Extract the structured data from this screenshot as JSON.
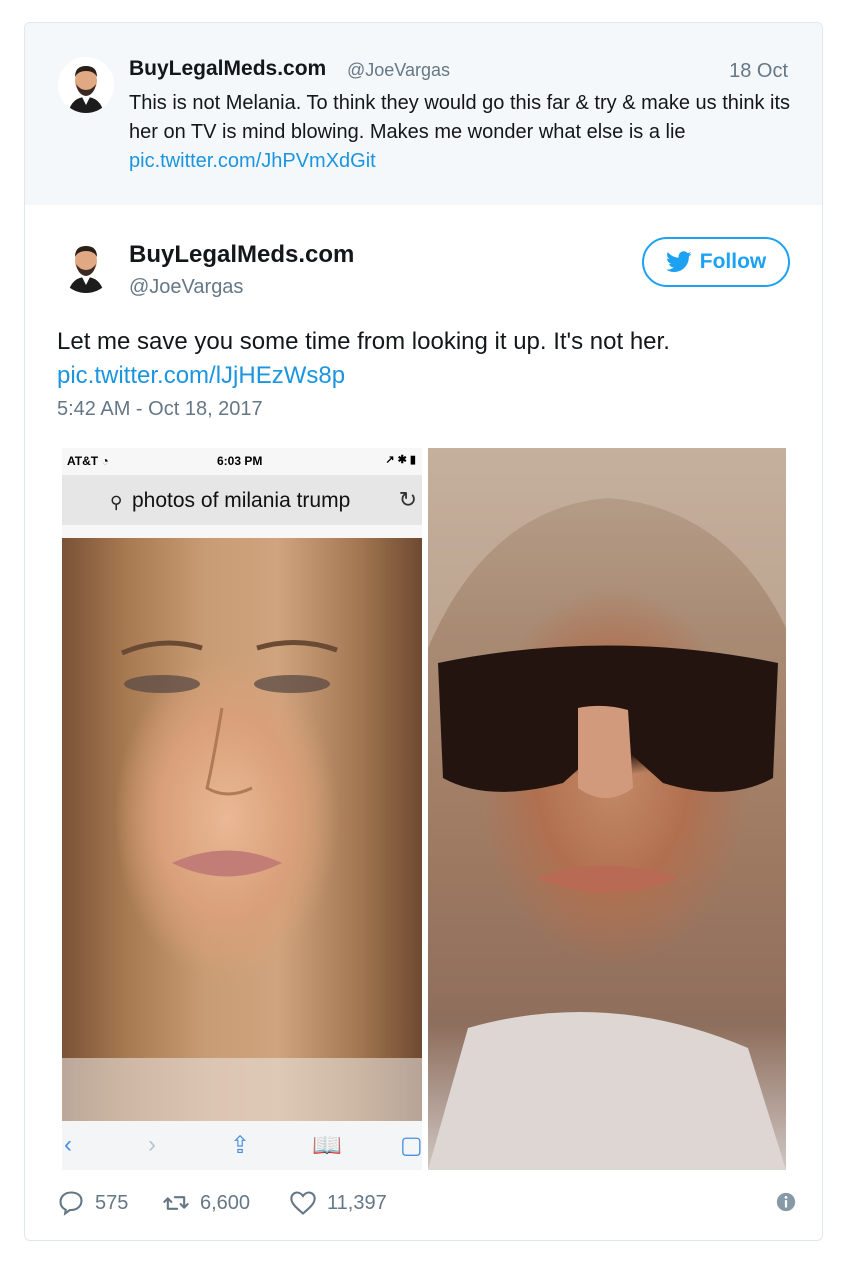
{
  "parent_tweet": {
    "name": "BuyLegalMeds.com",
    "handle": "@JoeVargas",
    "date": "18 Oct",
    "text": "This is not Melania. To think they would go this far & try & make us think its her on TV is mind blowing. Makes me wonder what else is a lie ",
    "link": "pic.twitter.com/JhPVmXdGit"
  },
  "main_tweet": {
    "name": "BuyLegalMeds.com",
    "handle": "@JoeVargas",
    "follow_label": "Follow",
    "text": "Let me save you some time from looking it up. It's not her.",
    "link": "pic.twitter.com/lJjHEzWs8p",
    "timestamp": "5:42 AM - Oct 18, 2017"
  },
  "media": {
    "status_carrier": "AT&T",
    "status_time": "6:03 PM",
    "status_right": "↗ ✱ ▮",
    "search_query": "photos of milania trump"
  },
  "actions": {
    "replies": "575",
    "retweets": "6,600",
    "likes": "11,397"
  },
  "icons": {
    "follow": "twitter-bird-icon",
    "reply": "reply-icon",
    "retweet": "retweet-icon",
    "like": "heart-icon",
    "info": "info-icon"
  },
  "colors": {
    "accent": "#1da1f2",
    "link": "#1b95e0",
    "muted": "#657786"
  }
}
